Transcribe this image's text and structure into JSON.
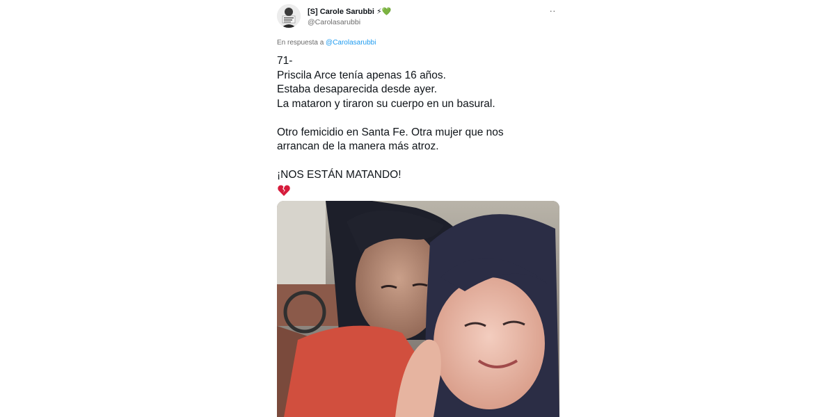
{
  "tweet": {
    "display_name": "[S] Carole Sarubbi",
    "name_emojis": "⚡💚",
    "handle": "@Carolasarubbi",
    "more_label": "··",
    "reply_prefix": "En respuesta a",
    "reply_handle": "@Carolasarubbi",
    "text_lines": [
      "71-",
      "Priscila Arce tenía apenas 16 años.",
      "Estaba desaparecida desde ayer.",
      "La mataron y tiraron su cuerpo en un basural.",
      "",
      "Otro femicidio en Santa Fe. Otra mujer que nos",
      "arrancan de la manera más atroz.",
      "",
      "¡NOS ESTÁN MATANDO!"
    ],
    "trailing_emoji": "broken-heart-icon",
    "media": {
      "type": "photo",
      "icon": "selfie-photo"
    }
  },
  "colors": {
    "link": "#1d9bf0",
    "secondary_text": "#6b6b6b",
    "primary_text": "#0f1419"
  }
}
